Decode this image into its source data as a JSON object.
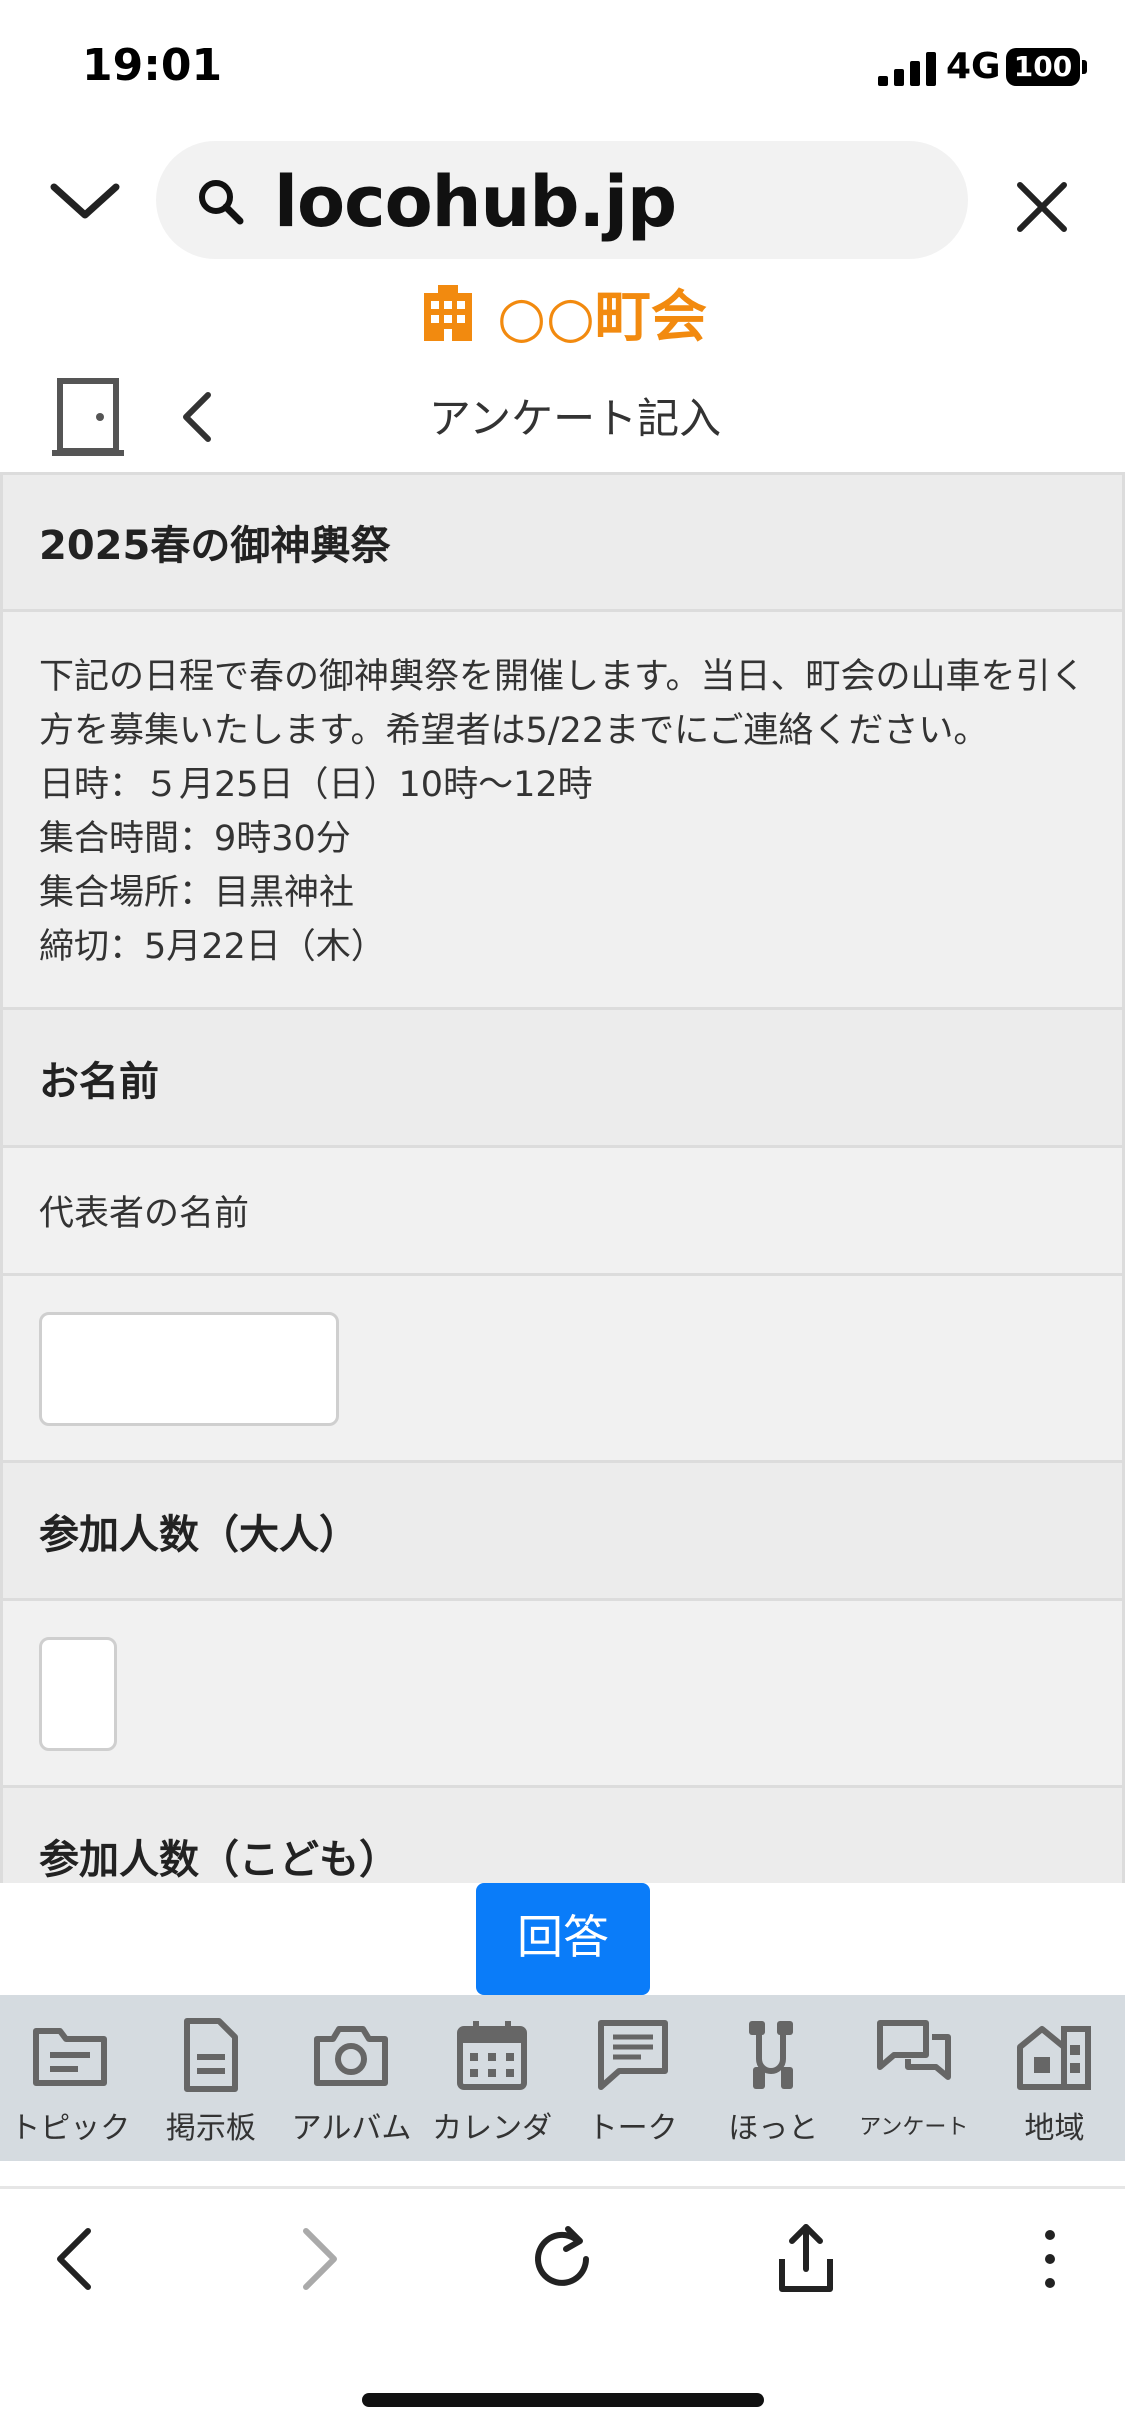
{
  "status_bar": {
    "time": "19:01",
    "network": "4G",
    "battery": "100"
  },
  "browser": {
    "url": "locohub.jp"
  },
  "site": {
    "name": "○○町会",
    "accent_color": "#f28a0f",
    "page_title": "アンケート記入"
  },
  "form": {
    "event_title": "2025春の御神輿祭",
    "description": "下記の日程で春の御神輿祭を開催します。当日、町会の山車を引く方を募集いたします。希望者は5/22までにご連絡ください。\n日時：５月25日（日）10時〜12時\n集合時間：9時30分\n集合場所：目黒神社\n締切：5月22日（木）",
    "name_heading": "お名前",
    "name_label": "代表者の名前",
    "name_value": "",
    "adult_heading": "参加人数（大人）",
    "adult_value": "",
    "child_heading": "参加人数（こども）"
  },
  "submit": {
    "label": "回答",
    "color": "#0a7cf9"
  },
  "tabs": [
    {
      "label": "トピック",
      "icon": "folder-icon"
    },
    {
      "label": "掲示板",
      "icon": "document-icon"
    },
    {
      "label": "アルバム",
      "icon": "camera-icon"
    },
    {
      "label": "カレンダ",
      "icon": "calendar-icon"
    },
    {
      "label": "トーク",
      "icon": "chat-icon"
    },
    {
      "label": "ほっと",
      "icon": "phone-icon"
    },
    {
      "label": "アンケート",
      "icon": "survey-icon"
    },
    {
      "label": "地域",
      "icon": "buildings-icon"
    }
  ]
}
